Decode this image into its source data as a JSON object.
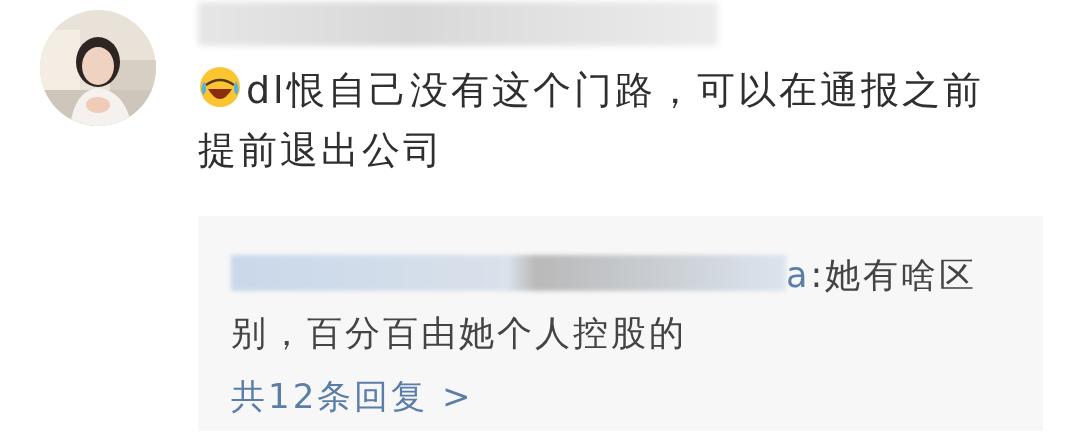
{
  "comment": {
    "author_redacted": true,
    "text": "dl恨自己没有这个门路，可以在通报之前提前退出公司",
    "reply": {
      "author_redacted": true,
      "author_tail": "a",
      "text": ":她有啥区别，百分百由她个人控股的"
    },
    "more_replies": "共12条回复 >"
  }
}
